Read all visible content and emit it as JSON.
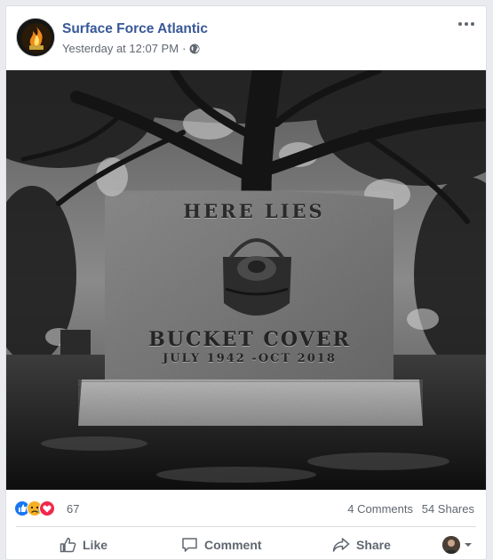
{
  "post": {
    "page_name": "Surface Force Atlantic",
    "timestamp": "Yesterday at 12:07 PM",
    "separator": "·",
    "audience_icon": "globe-icon",
    "more_icon": "more-options-icon"
  },
  "image": {
    "headline": "HERE LIES",
    "name": "BUCKET COVER",
    "dates": "JULY 1942 -OCT 2018"
  },
  "engagement": {
    "reaction_icons": [
      "like-reaction-icon",
      "sad-reaction-icon",
      "love-reaction-icon"
    ],
    "reaction_count": "67",
    "comments": "4 Comments",
    "shares": "54 Shares"
  },
  "actions": {
    "like_label": "Like",
    "comment_label": "Comment",
    "share_label": "Share"
  },
  "colors": {
    "link_blue": "#385898",
    "meta_gray": "#616770",
    "like_blue": "#1877f2",
    "love_red": "#f0284a",
    "sad_yellow": "#f7b125"
  }
}
